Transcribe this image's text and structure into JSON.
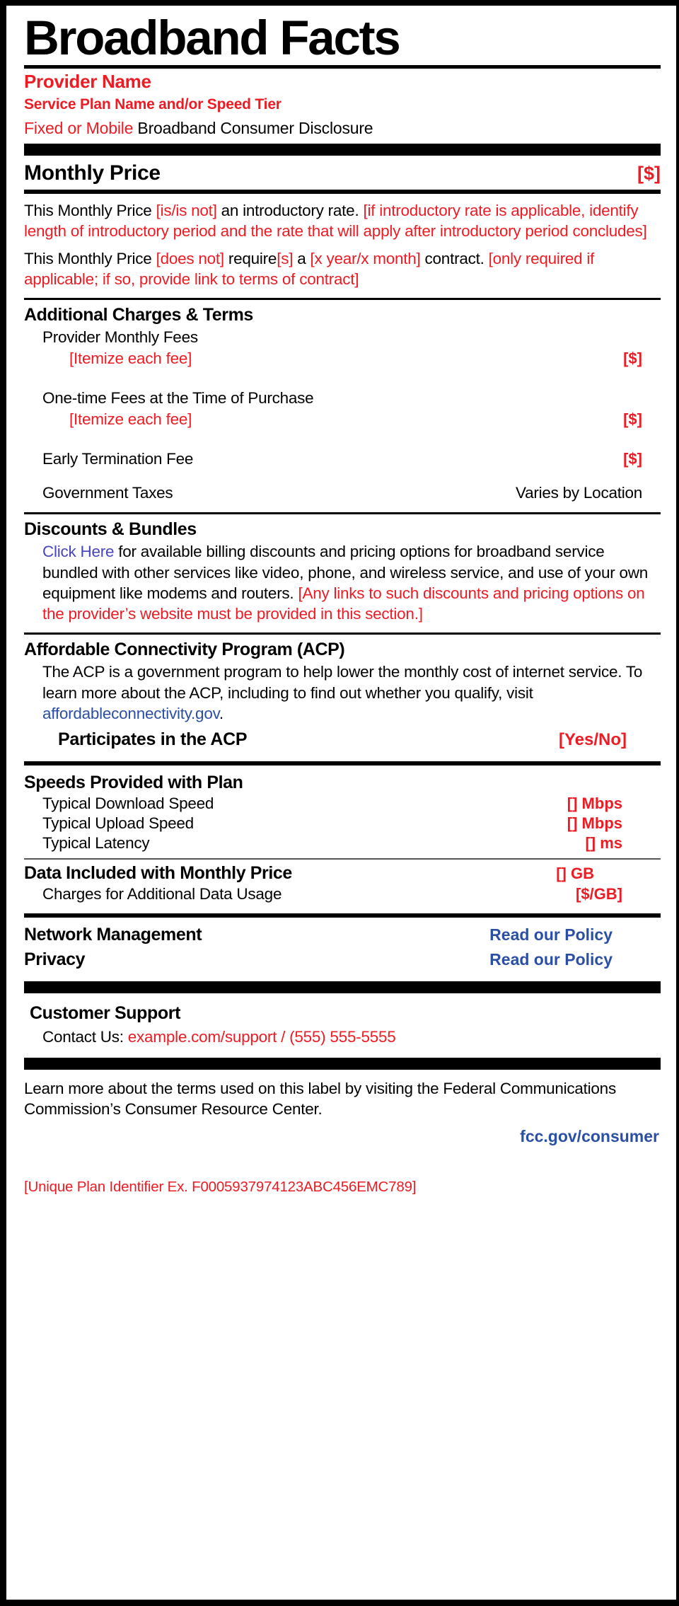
{
  "label": {
    "title": "Broadband Facts",
    "provider_name": "Provider Name",
    "plan_name": "Service Plan Name and/or Speed Tier",
    "disclosure_prefix": "Fixed or Mobile",
    "disclosure_rest": " Broadband Consumer Disclosure"
  },
  "colors": {
    "red": "#ED1C24",
    "blue": "#2B4FA5",
    "link_blue": "#4746BE",
    "black": "#000000"
  },
  "monthly_price": {
    "heading": "Monthly Price",
    "value": "[$]",
    "intro_p1_a": "This Monthly Price ",
    "intro_p1_b": "[is/is not]",
    "intro_p1_c": " an introductory rate. ",
    "intro_p1_d": "[if introductory rate is applicable, identify length of introductory period and the rate that will apply after introductory period concludes]",
    "intro_p2_a": "This Monthly Price ",
    "intro_p2_b": "[does not]",
    "intro_p2_c": " require",
    "intro_p2_d": "[s]",
    "intro_p2_e": " a ",
    "intro_p2_f": "[x year/x month]",
    "intro_p2_g": " contract. ",
    "intro_p2_h": "[only required if applicable; if so, provide link to terms of contract]"
  },
  "additional_charges": {
    "heading": "Additional Charges & Terms",
    "rows": [
      {
        "label": "Provider Monthly Fees",
        "value": ""
      },
      {
        "label": "[Itemize each fee]",
        "value": "[$]"
      },
      {
        "label": "One-time Fees at the Time of Purchase",
        "value": ""
      },
      {
        "label": "[Itemize each fee]",
        "value": "[$]"
      },
      {
        "label": "Early Termination Fee",
        "value": "[$]"
      },
      {
        "label": "Government Taxes",
        "value": "Varies by Location"
      }
    ]
  },
  "discounts": {
    "heading": "Discounts & Bundles",
    "link_text": "Click Here",
    "body_black": " for available billing discounts and pricing options for broadband service bundled with other services like video, phone, and wireless service, and use of your own equipment like modems and routers. ",
    "body_red": "[Any links to such discounts and pricing options on the provider’s website must be provided in this section.]"
  },
  "acp": {
    "heading": "Affordable Connectivity Program (ACP)",
    "body_a": "The ACP is a government program to help lower the monthly cost of internet service. To learn more about the ACP, including to find out whether you qualify, visit ",
    "body_link": "affordableconnectivity.gov",
    "body_b": ".",
    "participates_label": "Participates in the ACP",
    "participates_value": "[Yes/No]"
  },
  "speeds": {
    "heading": "Speeds Provided with Plan",
    "rows": [
      {
        "label": "Typical Download Speed",
        "value": "[] Mbps"
      },
      {
        "label": "Typical Upload Speed",
        "value": "[] Mbps"
      },
      {
        "label": "Typical Latency",
        "value": "[] ms"
      }
    ]
  },
  "data": {
    "heading": "Data Included with Monthly Price",
    "heading_value": "[] GB",
    "sub_label": "Charges for Additional Data Usage",
    "sub_value": "[$/GB]"
  },
  "policies": {
    "rows": [
      {
        "label": "Network Management",
        "value": "Read our Policy"
      },
      {
        "label": "Privacy",
        "value": "Read our Policy"
      }
    ]
  },
  "support": {
    "heading": "Customer Support",
    "contact_label": "Contact Us: ",
    "contact_value": "example.com/support / (555) 555-5555"
  },
  "footer": {
    "learn_more": "Learn more about the terms used on this label by visiting the Federal Communications Commission’s Consumer Resource Center.",
    "fcc_link": "fcc.gov/consumer",
    "unique_plan_id": "[Unique Plan Identifier Ex. F0005937974123ABC456EMC789]"
  }
}
